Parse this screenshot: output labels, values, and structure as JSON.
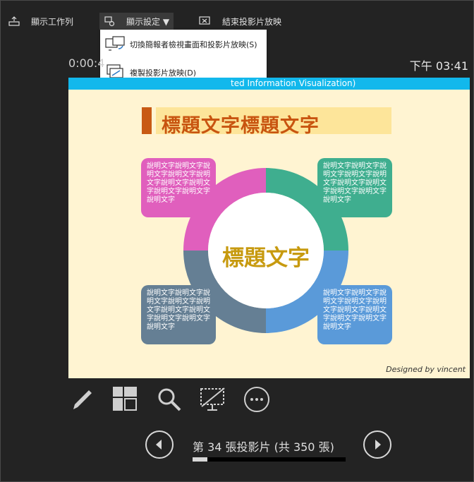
{
  "toolbar": {
    "taskbar_label": "顯示工作列",
    "display_settings_label": "顯示設定 ▼",
    "end_show_label": "結束投影片放映"
  },
  "menu": {
    "items": [
      {
        "label": "切換簡報者檢視畫面和投影片放映(S)",
        "icon": "swap-view-icon"
      },
      {
        "label": "複製投影片放映(D)",
        "icon": "duplicate-show-icon"
      }
    ]
  },
  "timer": "0:00:4",
  "clock": "下午 03:41",
  "slide": {
    "header_text": "ted Information Visualization)",
    "title": "標題文字標題文字",
    "center_title": "標題文字",
    "desc_top_left": "說明文字說明文字說明文字說明文字說明文字說明文字說明文字說明文字說明文字說明文字",
    "desc_top_right": "說明文字說明文字說明文字說明文字說明文字說明文字說明文字說明文字說明文字說明文字",
    "desc_bottom_left": "說明文字說明文字說明文字說明文字說明文字說明文字說明文字說明文字說明文字說明文字",
    "desc_bottom_right": "說明文字說明文字說明文字說明文字說明文字說明文字說明文字說明文字說明文字說明文字",
    "signature": "Designed by vincent",
    "colors": {
      "pink": "#e05fbd",
      "teal": "#3fae8f",
      "slate": "#657f94",
      "blue": "#5a9ad9"
    }
  },
  "tools": [
    "pen-icon",
    "all-slides-icon",
    "zoom-icon",
    "black-screen-icon",
    "more-options-icon"
  ],
  "navigation": {
    "counter": "第 34 張投影片 (共 350 張)",
    "current": 34,
    "total": 350
  }
}
